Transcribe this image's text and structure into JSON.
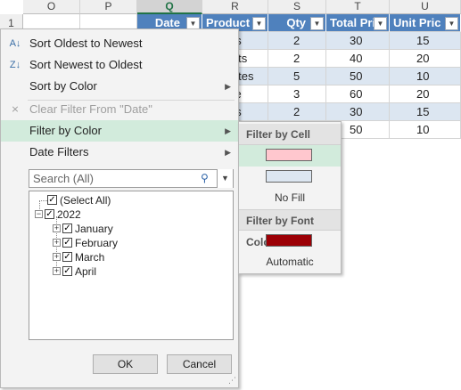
{
  "columns": [
    {
      "letter": "O"
    },
    {
      "letter": "P"
    },
    {
      "letter": "Q"
    },
    {
      "letter": "R"
    },
    {
      "letter": "S"
    },
    {
      "letter": "T"
    },
    {
      "letter": "U"
    }
  ],
  "row_number": "1",
  "headers": [
    "Date",
    "Product",
    "Qty",
    "Total Pri",
    "Unit Pric"
  ],
  "rows": [
    {
      "product": "ps",
      "qty": "2",
      "total": "30",
      "unit": "15"
    },
    {
      "product": "uits",
      "qty": "2",
      "total": "40",
      "unit": "20"
    },
    {
      "product": "lates",
      "qty": "5",
      "total": "50",
      "unit": "10"
    },
    {
      "product": "ke",
      "qty": "3",
      "total": "60",
      "unit": "20"
    },
    {
      "product": "ps",
      "qty": "2",
      "total": "30",
      "unit": "15"
    },
    {
      "product": "",
      "qty": "",
      "total": "50",
      "unit": "10"
    }
  ],
  "menu": {
    "sort_asc": "Sort Oldest to Newest",
    "sort_desc": "Sort Newest to Oldest",
    "sort_color": "Sort by Color",
    "clear_filter": "Clear Filter From \"Date\"",
    "filter_color": "Filter by Color",
    "date_filters": "Date Filters"
  },
  "search": {
    "placeholder": "Search (All)"
  },
  "tree": {
    "select_all": "(Select All)",
    "year": "2022",
    "months": [
      "January",
      "February",
      "March",
      "April"
    ]
  },
  "buttons": {
    "ok": "OK",
    "cancel": "Cancel"
  },
  "submenu": {
    "cell_header": "Filter by Cell Color",
    "no_fill": "No Fill",
    "font_header": "Filter by Font Color",
    "automatic": "Automatic"
  },
  "colors": {
    "header_blue": "#4f81bd",
    "band_blue": "#dce6f1",
    "hover_green": "#d2ebdc",
    "cell_swatch_pink": "#ffc7ce",
    "cell_swatch_blue": "#dce6f1",
    "font_swatch_darkred": "#9c0006"
  }
}
